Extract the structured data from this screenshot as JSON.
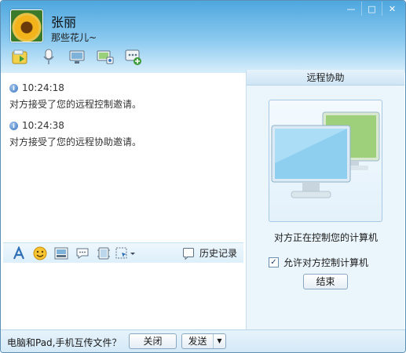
{
  "contact": {
    "name": "张丽",
    "signature": "那些花儿~"
  },
  "window_buttons": {
    "minimize": "—",
    "maximize": "□",
    "close": "✕"
  },
  "toolbar": {
    "items": [
      {
        "icon": "file-transfer-icon"
      },
      {
        "icon": "microphone-icon"
      },
      {
        "icon": "video-icon"
      },
      {
        "icon": "remote-assist-icon"
      },
      {
        "icon": "more-apps-icon"
      }
    ]
  },
  "messages": [
    {
      "time": "10:24:18",
      "text": "对方接受了您的远程控制邀请。"
    },
    {
      "time": "10:24:38",
      "text": "对方接受了您的远程协助邀请。"
    }
  ],
  "format_bar": {
    "icons": [
      "font-icon",
      "emoji-icon",
      "image-icon",
      "quick-reply-icon",
      "screenshot-icon",
      "screen-capture-dropdown-icon"
    ],
    "history_label": "历史记录"
  },
  "side_panel": {
    "title": "远程协助",
    "status": "对方正在控制您的计算机",
    "allow_label": "允许对方控制计算机",
    "allow_checked": true,
    "end_label": "结束"
  },
  "bottom": {
    "transfer_tip": "电脑和Pad,手机互传文件？",
    "close_label": "关闭",
    "send_label": "发送"
  },
  "colors": {
    "title_gradient_top": "#4ea7de",
    "panel_bg": "#eaf5fc",
    "accent": "#3d77c2"
  }
}
